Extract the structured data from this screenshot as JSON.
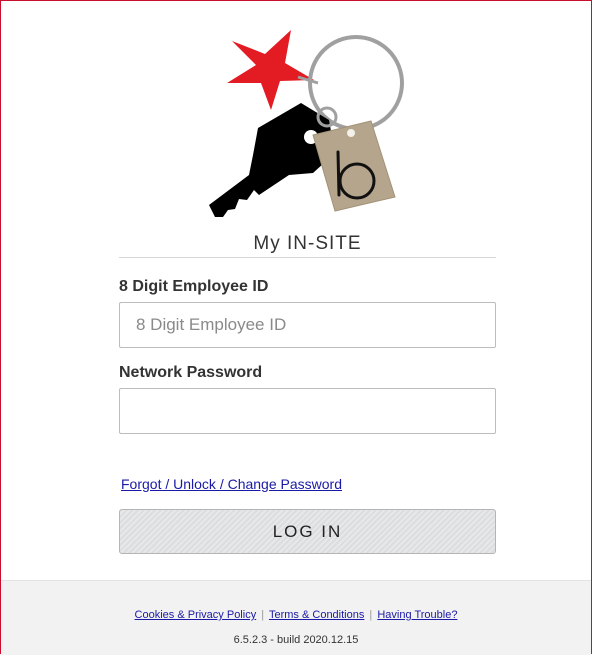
{
  "header": {
    "site_title": "My IN-SITE",
    "logo_letter": "b"
  },
  "form": {
    "employee_id": {
      "label": "8 Digit Employee ID",
      "placeholder": "8 Digit Employee ID",
      "value": ""
    },
    "password": {
      "label": "Network Password",
      "placeholder": "",
      "value": ""
    },
    "forgot_link": "Forgot / Unlock / Change Password",
    "login_label": "LOG IN"
  },
  "footer": {
    "links": [
      "Cookies & Privacy Policy",
      "Terms & Conditions",
      "Having Trouble?"
    ],
    "separator": "|",
    "build_info": "6.5.2.3 - build 2020.12.15"
  },
  "colors": {
    "accent_red": "#e31b23",
    "border_red": "#c8102e",
    "link_blue": "#1a1aa6",
    "tag_tan": "#b4a58c"
  }
}
